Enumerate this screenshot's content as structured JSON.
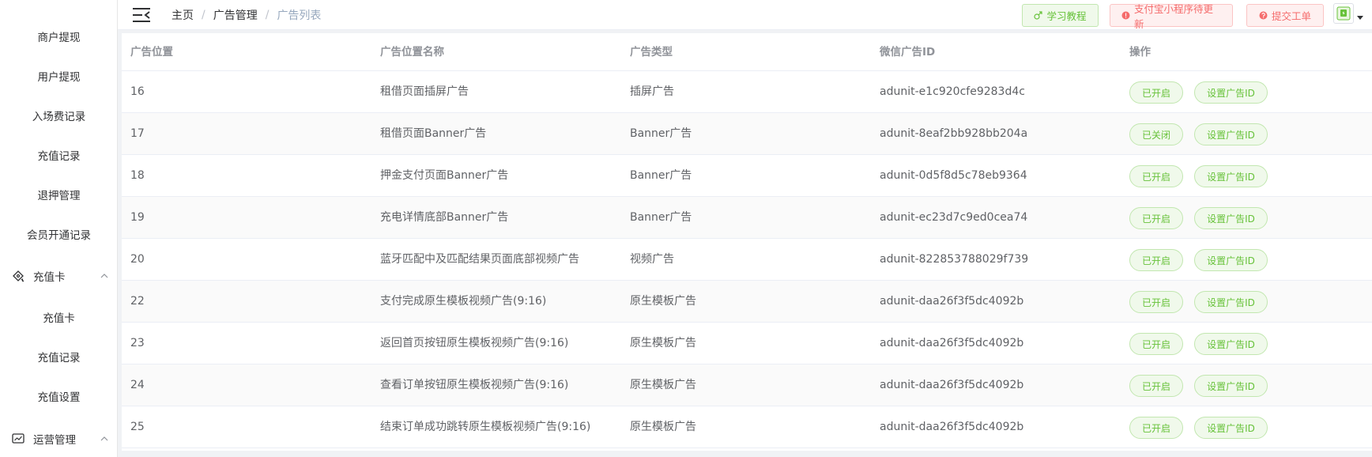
{
  "sidebar": {
    "items": [
      {
        "label": "商户提现"
      },
      {
        "label": "用户提现"
      },
      {
        "label": "入场费记录"
      },
      {
        "label": "充值记录"
      },
      {
        "label": "退押管理"
      },
      {
        "label": "会员开通记录"
      }
    ],
    "group_recharge_card": {
      "label": "充值卡",
      "icon": "ticket-icon",
      "children": [
        {
          "label": "充值卡"
        },
        {
          "label": "充值记录"
        },
        {
          "label": "充值设置"
        }
      ]
    },
    "group_operations": {
      "label": "运营管理",
      "icon": "chart-icon"
    }
  },
  "header": {
    "breadcrumb": [
      "主页",
      "广告管理",
      "广告列表"
    ],
    "separator": "/",
    "learn_button": "学习教程",
    "alipay_button": "支付宝小程序待更新",
    "ticket_button": "提交工单"
  },
  "table": {
    "columns": [
      "广告位置",
      "广告位置名称",
      "广告类型",
      "微信广告ID",
      "操作"
    ],
    "set_id_label": "设置广告ID",
    "rows": [
      {
        "pos": "16",
        "name": "租借页面插屏广告",
        "type": "插屏广告",
        "ad_id": "adunit-e1c920cfe9283d4c",
        "status": "已开启"
      },
      {
        "pos": "17",
        "name": "租借页面Banner广告",
        "type": "Banner广告",
        "ad_id": "adunit-8eaf2bb928bb204a",
        "status": "已关闭"
      },
      {
        "pos": "18",
        "name": "押金支付页面Banner广告",
        "type": "Banner广告",
        "ad_id": "adunit-0d5f8d5c78eb9364",
        "status": "已开启"
      },
      {
        "pos": "19",
        "name": "充电详情底部Banner广告",
        "type": "Banner广告",
        "ad_id": "adunit-ec23d7c9ed0cea74",
        "status": "已开启"
      },
      {
        "pos": "20",
        "name": "蓝牙匹配中及匹配结果页面底部视频广告",
        "type": "视频广告",
        "ad_id": "adunit-822853788029f739",
        "status": "已开启"
      },
      {
        "pos": "22",
        "name": "支付完成原生模板视频广告(9:16)",
        "type": "原生模板广告",
        "ad_id": "adunit-daa26f3f5dc4092b",
        "status": "已开启"
      },
      {
        "pos": "23",
        "name": "返回首页按钮原生模板视频广告(9:16)",
        "type": "原生模板广告",
        "ad_id": "adunit-daa26f3f5dc4092b",
        "status": "已开启"
      },
      {
        "pos": "24",
        "name": "查看订单按钮原生模板视频广告(9:16)",
        "type": "原生模板广告",
        "ad_id": "adunit-daa26f3f5dc4092b",
        "status": "已开启"
      },
      {
        "pos": "25",
        "name": "结束订单成功跳转原生模板视频广告(9:16)",
        "type": "原生模板广告",
        "ad_id": "adunit-daa26f3f5dc4092b",
        "status": "已开启"
      }
    ]
  },
  "colors": {
    "success": "#67c23a",
    "danger": "#f56c6c",
    "muted": "#97a8be"
  }
}
